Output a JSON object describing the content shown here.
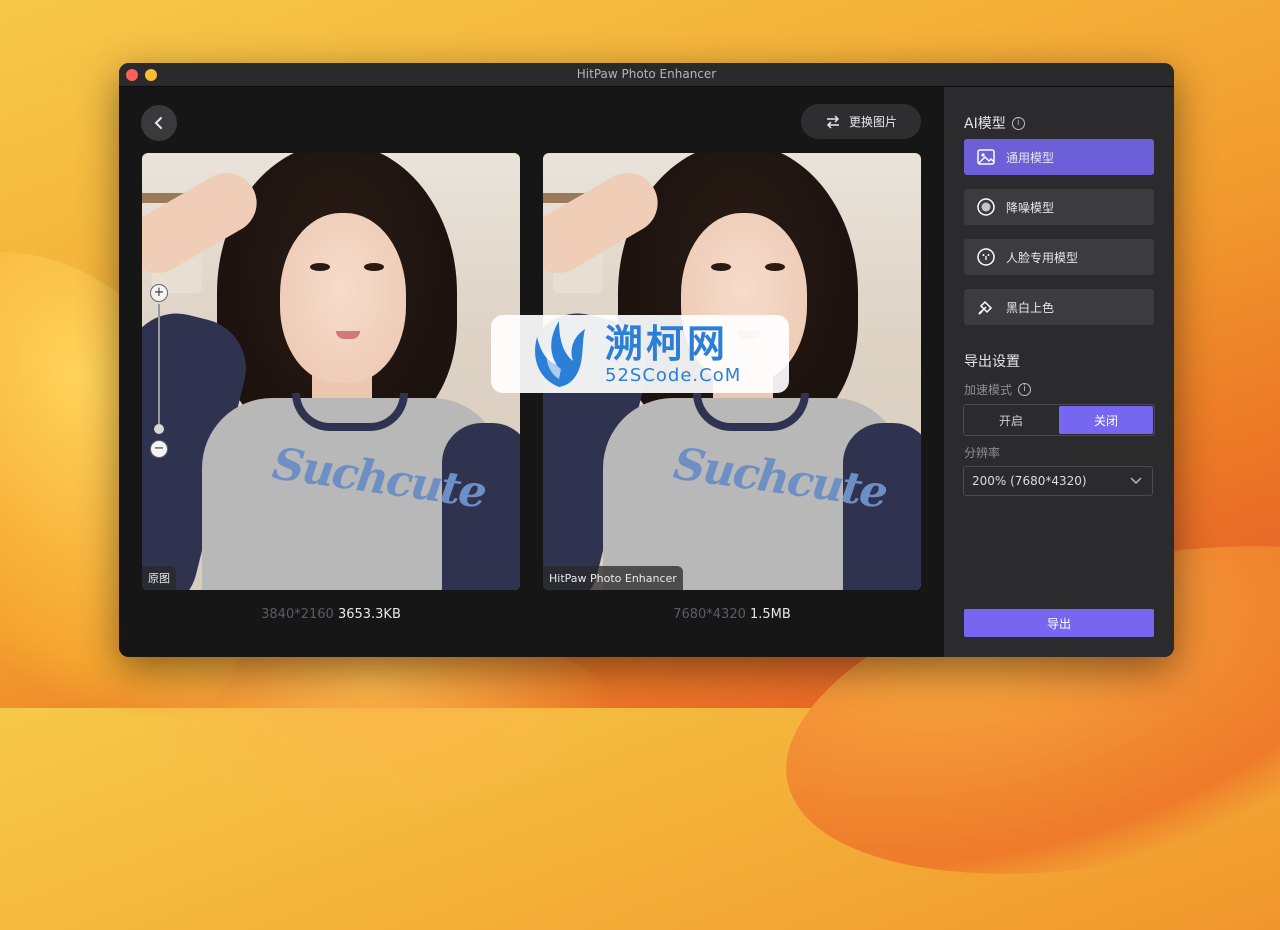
{
  "window": {
    "title": "HitPaw Photo Enhancer"
  },
  "toolbar": {
    "replace_label": "更换图片"
  },
  "preview": {
    "original_label": "原图",
    "enhanced_label": "HitPaw Photo Enhancer",
    "original_resolution": "3840*2160",
    "original_size": "3653.3KB",
    "enhanced_resolution": "7680*4320",
    "enhanced_size": "1.5MB",
    "shirt_print": "Suchcute"
  },
  "watermark": {
    "cn": "溯柯网",
    "en": "52SCode.CoM"
  },
  "panel": {
    "ai_model_title": "AI模型",
    "models": [
      {
        "label": "通用模型",
        "icon": "image-icon",
        "active": true
      },
      {
        "label": "降噪模型",
        "icon": "denoise-icon",
        "active": false
      },
      {
        "label": "人脸专用模型",
        "icon": "face-icon",
        "active": false
      },
      {
        "label": "黑白上色",
        "icon": "brush-icon",
        "active": false
      }
    ],
    "export_settings_title": "导出设置",
    "accel_label": "加速模式",
    "accel_on": "开启",
    "accel_off": "关闭",
    "resolution_label": "分辨率",
    "resolution_value": "200% (7680*4320)",
    "export_label": "导出"
  },
  "colors": {
    "accent": "#7767f0",
    "active_model": "#6d5fd8"
  }
}
